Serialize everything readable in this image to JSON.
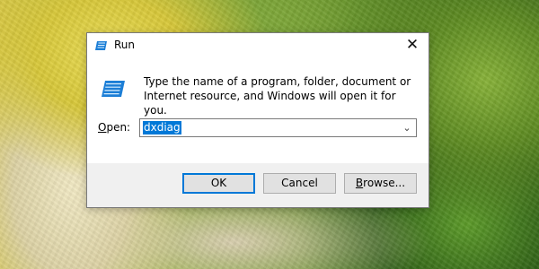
{
  "dialog": {
    "title": "Run",
    "close_symbol": "✕",
    "description": "Type the name of a program, folder, document or Internet resource, and Windows will open it for you.",
    "open_label_prefix": "",
    "open_label_underlined": "O",
    "open_label_suffix": "pen:",
    "input_value": "dxdiag",
    "dropdown_symbol": "⌄",
    "buttons": {
      "ok": "OK",
      "cancel": "Cancel",
      "browse_prefix": "",
      "browse_underlined": "B",
      "browse_suffix": "rowse..."
    }
  },
  "icons": {
    "title": "run-icon",
    "content": "run-large-icon",
    "close": "close-icon",
    "dropdown": "chevron-down-icon"
  },
  "colors": {
    "accent": "#0078d7",
    "dialog_background": "#f0f0f0",
    "content_background": "#ffffff"
  }
}
